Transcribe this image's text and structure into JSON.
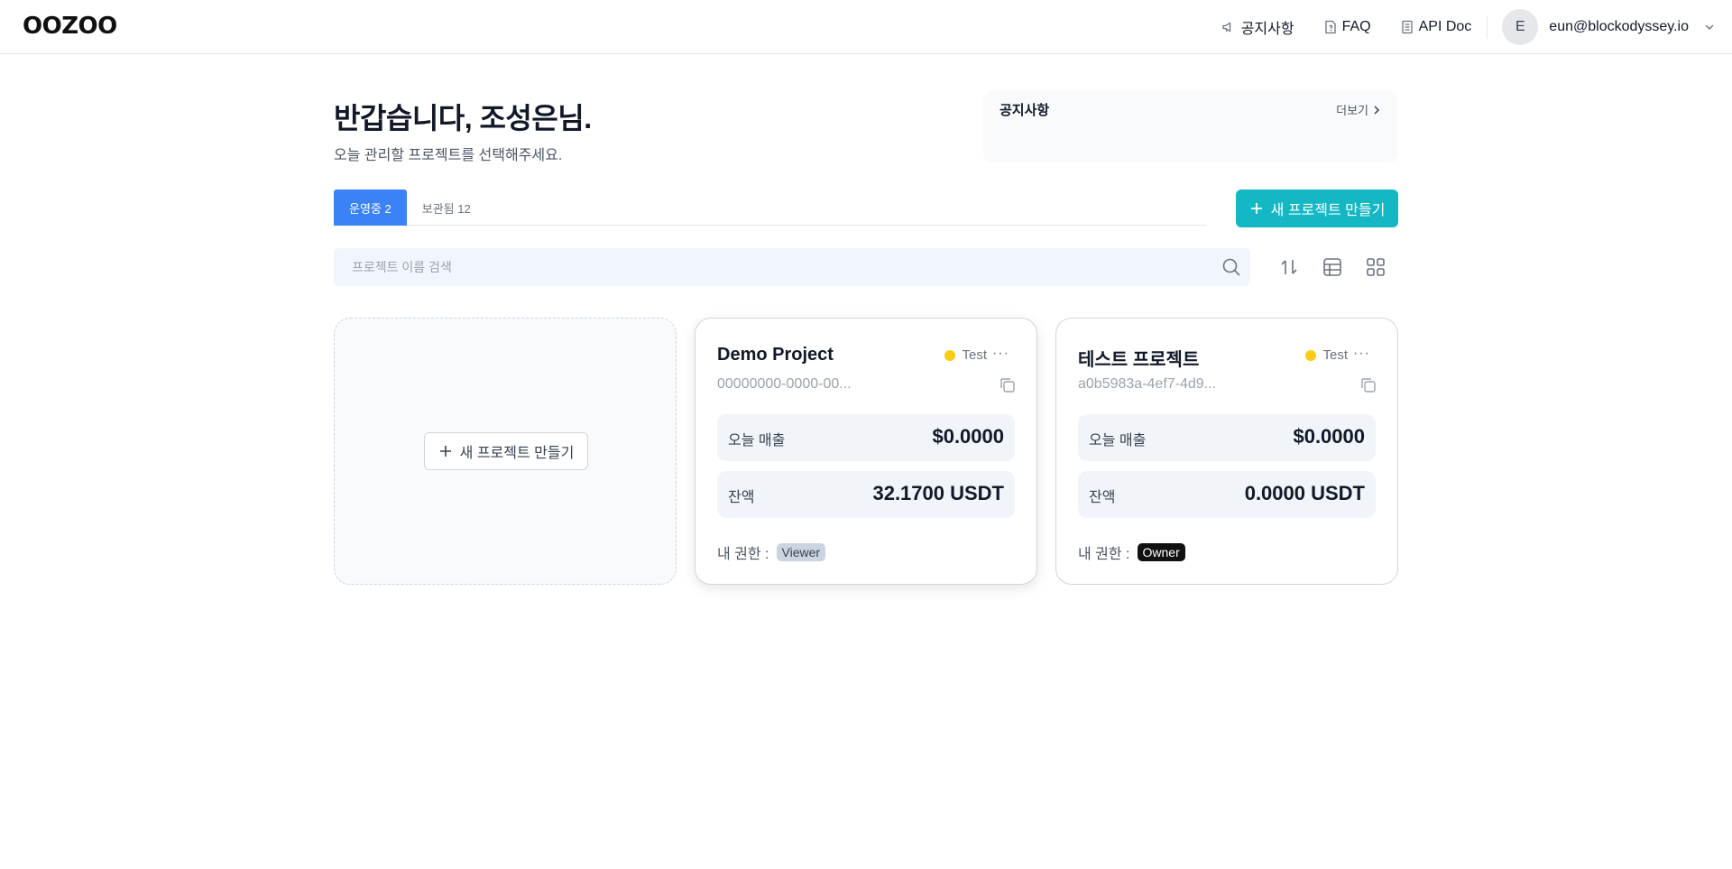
{
  "header": {
    "logo": "OOZOO",
    "nav": [
      {
        "label": "공지사항",
        "icon": "megaphone-icon"
      },
      {
        "label": "FAQ",
        "icon": "help-doc-icon"
      },
      {
        "label": "API Doc",
        "icon": "document-icon"
      }
    ],
    "user": {
      "initial": "E",
      "email": "eun@blockodyssey.io"
    }
  },
  "greeting": {
    "title": "반갑습니다, 조성은님.",
    "subtitle": "오늘 관리할 프로젝트를 선택해주세요."
  },
  "notice": {
    "title": "공지사항",
    "more_label": "더보기"
  },
  "tabs": [
    {
      "label": "운영중 2",
      "active": true
    },
    {
      "label": "보관됨 12",
      "active": false
    }
  ],
  "new_project_label": "새 프로젝트 만들기",
  "search": {
    "placeholder": "프로젝트 이름 검색"
  },
  "empty_card": {
    "button_label": "새 프로젝트 만들기"
  },
  "projects": [
    {
      "name": "Demo Project",
      "status": "Test",
      "id": "00000000-0000-00...",
      "sales_label": "오늘 매출",
      "sales_value": "$0.0000",
      "balance_label": "잔액",
      "balance_value": "32.1700 USDT",
      "role_label": "내 권한 :",
      "role": "Viewer"
    },
    {
      "name": "테스트 프로젝트",
      "status": "Test",
      "id": "a0b5983a-4ef7-4d9...",
      "sales_label": "오늘 매출",
      "sales_value": "$0.0000",
      "balance_label": "잔액",
      "balance_value": "0.0000 USDT",
      "role_label": "내 권한 :",
      "role": "Owner"
    }
  ],
  "colors": {
    "accent_blue": "#3b82f6",
    "teal": "#14b8c4",
    "status_yellow": "#facc15"
  }
}
